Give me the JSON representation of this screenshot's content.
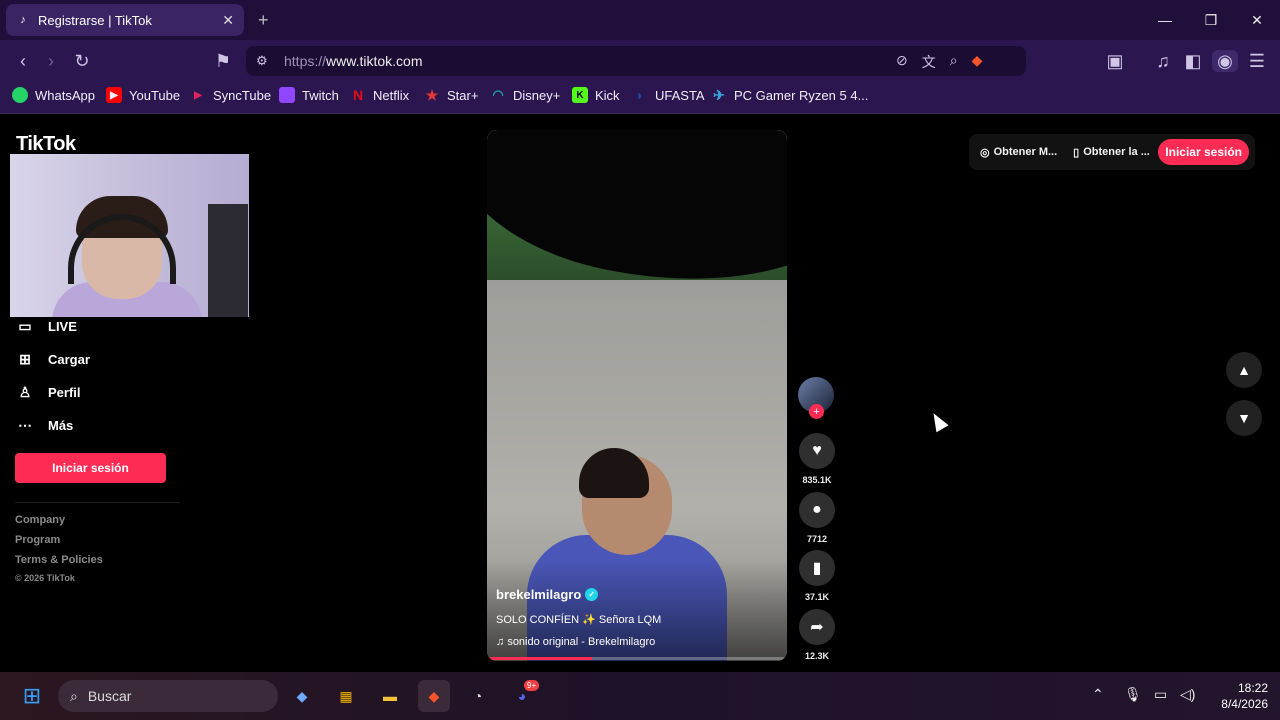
{
  "browser": {
    "tab_title": "Registrarse | TikTok",
    "tab_close": "✕",
    "new_tab": "+",
    "url_scheme": "https://",
    "url_host": "www.tiktok.com",
    "window_controls": [
      "—",
      "❐",
      "✕"
    ]
  },
  "bookmarks": [
    {
      "label": "WhatsApp",
      "color": "#25d366"
    },
    {
      "label": "YouTube",
      "color": "#ff0000"
    },
    {
      "label": "SyncTube",
      "color": "#e0245e"
    },
    {
      "label": "Twitch",
      "color": "#9146ff"
    },
    {
      "label": "Netflix",
      "color": "#e50914"
    },
    {
      "label": "Star+",
      "color": "#e53935"
    },
    {
      "label": "Disney+",
      "color": "#1fa0a0"
    },
    {
      "label": "Kick",
      "color": "#53fc18"
    },
    {
      "label": "UFASTA",
      "color": "#1f4aa8"
    },
    {
      "label": "PC Gamer Ryzen 5 4...",
      "color": "#3aa0d8"
    }
  ],
  "tiktok": {
    "logo": "TikTok",
    "sidebar": [
      {
        "label": "LIVE",
        "icon": "live-icon"
      },
      {
        "label": "Cargar",
        "icon": "upload-icon"
      },
      {
        "label": "Perfil",
        "icon": "profile-icon"
      },
      {
        "label": "Más",
        "icon": "more-icon"
      }
    ],
    "login_button": "Iniciar sesión",
    "footer": [
      "Company",
      "Program",
      "Terms & Policies",
      "© 2026 TikTok"
    ],
    "video": {
      "username": "brekelmilagro",
      "caption": "SOLO CONFÍEN ✨ Señora LQM",
      "sound": "sonido original - Brekelmilagro",
      "progress": 0.35
    },
    "actions": {
      "likes": "835.1K",
      "comments": "7712",
      "saves": "37.1K",
      "shares": "12.3K"
    },
    "topbar": {
      "get_app_1": "Obtener M...",
      "get_app_2": "Obtener la ...",
      "login": "Iniciar sesión"
    }
  },
  "taskbar": {
    "search_placeholder": "Buscar",
    "time": "18:22",
    "date": "8/4/2026",
    "discord_badge": "9+"
  }
}
